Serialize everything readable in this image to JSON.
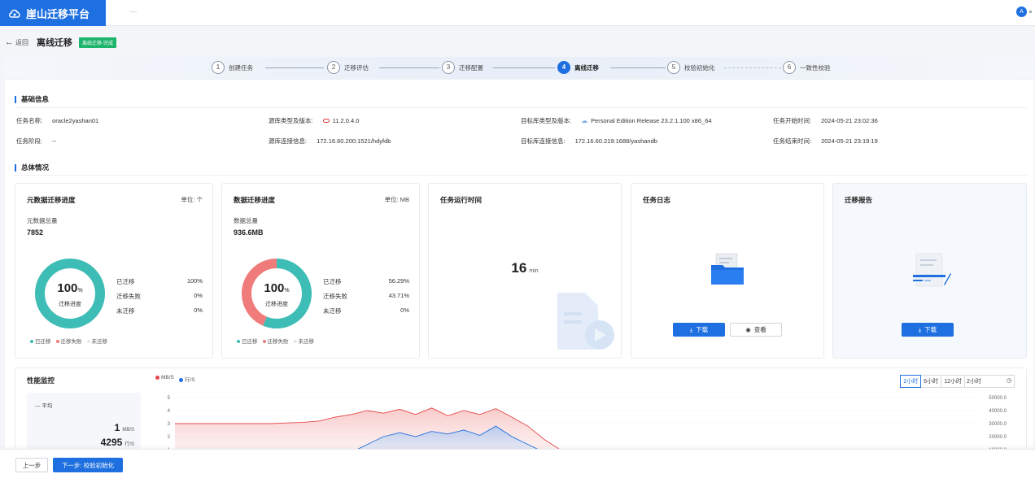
{
  "app": {
    "title": "崖山迁移平台",
    "top_dash": "—",
    "avatar": "A"
  },
  "header": {
    "back": "返回",
    "title": "离线迁移",
    "status_tag": "离线迁移-完成"
  },
  "steps": [
    {
      "num": "1",
      "label": "创建任务"
    },
    {
      "num": "2",
      "label": "迁移评估"
    },
    {
      "num": "3",
      "label": "迁移配置"
    },
    {
      "num": "4",
      "label": "离线迁移"
    },
    {
      "num": "5",
      "label": "校验初始化"
    },
    {
      "num": "6",
      "label": "一致性校验"
    }
  ],
  "active_step": 4,
  "basic": {
    "title": "基础信息",
    "task_name_label": "任务名称:",
    "task_name": "oracle2yashan01",
    "task_stage_label": "任务阶段:",
    "task_stage": "--",
    "src_type_label": "源库类型及版本:",
    "src_type": "11.2.0.4.0",
    "src_conn_label": "源库连接信息:",
    "src_conn": "172.16.60.200:1521/hdyfdb",
    "tgt_type_label": "目标库类型及版本:",
    "tgt_type": "Personal Edition Release 23.2.1.100 x86_64",
    "tgt_conn_label": "目标库连接信息:",
    "tgt_conn": "172.16.60.219:1688/yashandb",
    "start_label": "任务开始时间:",
    "start": "2024-05-21 23:02:36",
    "end_label": "任务结束时间:",
    "end": "2024-05-21 23:19:19"
  },
  "overview": {
    "title": "总体情况"
  },
  "meta": {
    "title": "元数据迁移进度",
    "unit": "单位: 个",
    "total_label": "元数据总量",
    "total": "7852",
    "pct": "100",
    "pct_unit": "%",
    "center_label": "迁移进度",
    "rows": [
      {
        "k": "已迁移",
        "v": "100%"
      },
      {
        "k": "迁移失败",
        "v": "0%"
      },
      {
        "k": "未迁移",
        "v": "0%"
      }
    ],
    "fractions": {
      "migrated": 1.0,
      "failed": 0.0,
      "pending": 0.0
    },
    "legend": [
      "已迁移",
      "迁移失败",
      "未迁移"
    ]
  },
  "data": {
    "title": "数据迁移进度",
    "unit": "单位: MB",
    "total_label": "数据总量",
    "total": "936.6MB",
    "pct": "100",
    "pct_unit": "%",
    "center_label": "迁移进度",
    "rows": [
      {
        "k": "已迁移",
        "v": "56.29%"
      },
      {
        "k": "迁移失败",
        "v": "43.71%"
      },
      {
        "k": "未迁移",
        "v": "0%"
      }
    ],
    "fractions": {
      "migrated": 0.5629,
      "failed": 0.4371,
      "pending": 0.0
    },
    "legend": [
      "已迁移",
      "迁移失败",
      "未迁移"
    ]
  },
  "runtime": {
    "title": "任务运行时间",
    "value": "16",
    "unit": "min"
  },
  "tasklog": {
    "title": "任务日志",
    "download": "下载",
    "view": "查看"
  },
  "report": {
    "title": "迁移报告",
    "download": "下载"
  },
  "perf": {
    "title": "性能监控",
    "legend": [
      "MB/S",
      "行/S"
    ],
    "ranges": [
      "2小时",
      "6小时",
      "12小时",
      "2小时"
    ],
    "selected_range": "2小时",
    "avg_label": "平均",
    "avg_mb": "1",
    "avg_mb_unit": "MB/S",
    "avg_rows": "4295",
    "avg_rows_unit": "行/S",
    "left_ticks": [
      "5",
      "4",
      "3",
      "2",
      "1",
      "0"
    ],
    "right_ticks": [
      "50000.0",
      "40000.0",
      "30000.0",
      "20000.0",
      "10000.0",
      "0.0"
    ]
  },
  "footer": {
    "prev": "上一步",
    "next": "下一步: 校验初始化"
  },
  "colors": {
    "accent": "#1e6fe0",
    "teal": "#3dbdb5",
    "salmon": "#ef7b7b",
    "success": "#1db46b"
  },
  "chart_data": {
    "type": "area",
    "series": [
      {
        "name": "MB/S",
        "axis": "left",
        "values": [
          3.0,
          3.0,
          3.0,
          3.0,
          3.0,
          3.0,
          3.0,
          3.05,
          3.1,
          3.2,
          3.5,
          3.7,
          4.0,
          3.8,
          4.1,
          3.7,
          4.2,
          3.6,
          4.0,
          3.7,
          4.15,
          3.5,
          2.8,
          1.8,
          1.0,
          0.5,
          0.25,
          0.1,
          0.05,
          0.02,
          0.01,
          0.01,
          0.01,
          0.02,
          0.05,
          0.1,
          0.1,
          0.05,
          0.05,
          0.05,
          0.05,
          0.05,
          0.05,
          0.05,
          0.05,
          0.05,
          0.05,
          0.05,
          0.05,
          0.05,
          0.1
        ]
      },
      {
        "name": "行/S",
        "axis": "right",
        "values": [
          0,
          0,
          0,
          0,
          0,
          0,
          0,
          0,
          0,
          2000,
          5000,
          8000,
          14000,
          20000,
          23000,
          20000,
          24000,
          22000,
          25000,
          21000,
          28000,
          20000,
          14000,
          8000,
          4000,
          2000,
          1000,
          500,
          200,
          100,
          50,
          20,
          10,
          0,
          0,
          0,
          0,
          0,
          0,
          0,
          0,
          0,
          0,
          0,
          0,
          0,
          0,
          0,
          0,
          0,
          0
        ]
      }
    ],
    "ylim_left": [
      0,
      5
    ],
    "ylim_right": [
      0,
      50000
    ]
  }
}
